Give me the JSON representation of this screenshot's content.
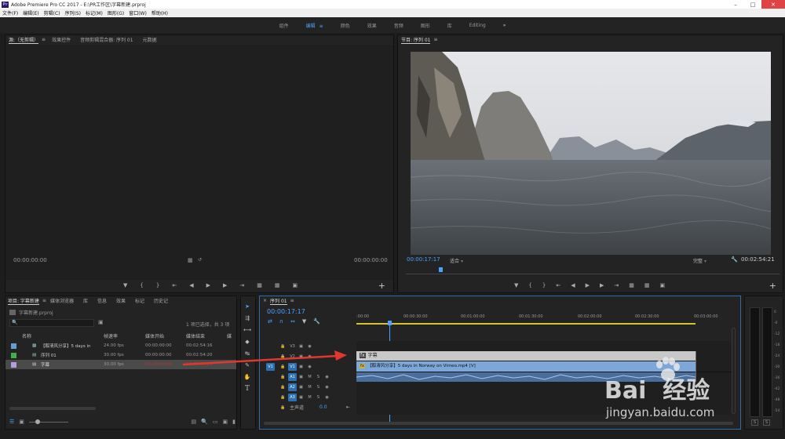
{
  "app": {
    "title": "Adobe Premiere Pro CC 2017 - E:\\PR工作区\\字幕新建.prproj",
    "logo_text": "Pr"
  },
  "menu": [
    "文件(F)",
    "编辑(E)",
    "剪辑(C)",
    "序列(S)",
    "标记(M)",
    "图形(G)",
    "窗口(W)",
    "帮助(H)"
  ],
  "workspaces": {
    "items": [
      "组件",
      "编辑",
      "颜色",
      "效果",
      "音频",
      "图形",
      "库",
      "Editing"
    ],
    "active": "编辑",
    "more": "»"
  },
  "source_panel": {
    "tabs": [
      "源:（无剪辑）",
      "效果控件",
      "音频剪辑混合器: 序列 01",
      "元数据"
    ],
    "timecode_left": "00:00:00:00",
    "timecode_right": "00:00:00:00"
  },
  "program_panel": {
    "tab": "节目: 序列 01",
    "timecode": "00:00:17:17",
    "fit": "适合",
    "quality": "完整",
    "duration": "00:02:54:21"
  },
  "project_panel": {
    "tabs": [
      "项目: 字幕新建",
      "媒体浏览器",
      "库",
      "信息",
      "效果",
      "标记",
      "历史记"
    ],
    "file": "字幕新建.prproj",
    "selection": "1 项已选择，共 3 项",
    "columns": [
      "名称",
      "帧速率",
      "媒体开始",
      "媒体结束",
      "媒"
    ],
    "rows": [
      {
        "name": "【醇清风分享】5 days in",
        "fps": "24.00 fps",
        "start": "00:00:00:00",
        "end": "00:02:54:16",
        "color": "#6a9ad6"
      },
      {
        "name": "序列 01",
        "fps": "30.00 fps",
        "start": "00:00:00:00",
        "end": "00:02:54:20",
        "color": "#3fb04a"
      },
      {
        "name": "字幕",
        "fps": "30.00 fps",
        "start": "00:00:00:00",
        "end": "00:00:05:24",
        "color": "#b89ce0"
      }
    ]
  },
  "timeline": {
    "tab": "序列 01",
    "timecode": "00:00:17:17",
    "ruler": [
      ":00:00",
      "00:00:30:00",
      "00:01:00:00",
      "00:01:30:00",
      "00:02:00:00",
      "00:02:30:00",
      "00:03:00:00"
    ],
    "video_tracks": [
      "V3",
      "V2",
      "V1"
    ],
    "audio_tracks": [
      "A1",
      "A2",
      "A3"
    ],
    "source_patch_v": "V1",
    "master": "主声道",
    "master_value": "0.0",
    "title_clip": "字幕",
    "video_clip": "【醇清风分享】5 days in Norway on Vimeo.mp4 [V]",
    "track_letters": {
      "m": "M",
      "s": "S"
    }
  },
  "meters": {
    "labels": [
      "0",
      "-6",
      "-12",
      "-18",
      "-24",
      "-30",
      "-36",
      "-42",
      "-48",
      "-54"
    ],
    "bottom": [
      "S",
      "S"
    ]
  },
  "watermark": {
    "brand": "Bai  经验",
    "url": "jingyan.baidu.com"
  },
  "colors": {
    "accent": "#4aa1ff",
    "playhead": "#4aa1ff",
    "arrow": "#e0382e"
  }
}
